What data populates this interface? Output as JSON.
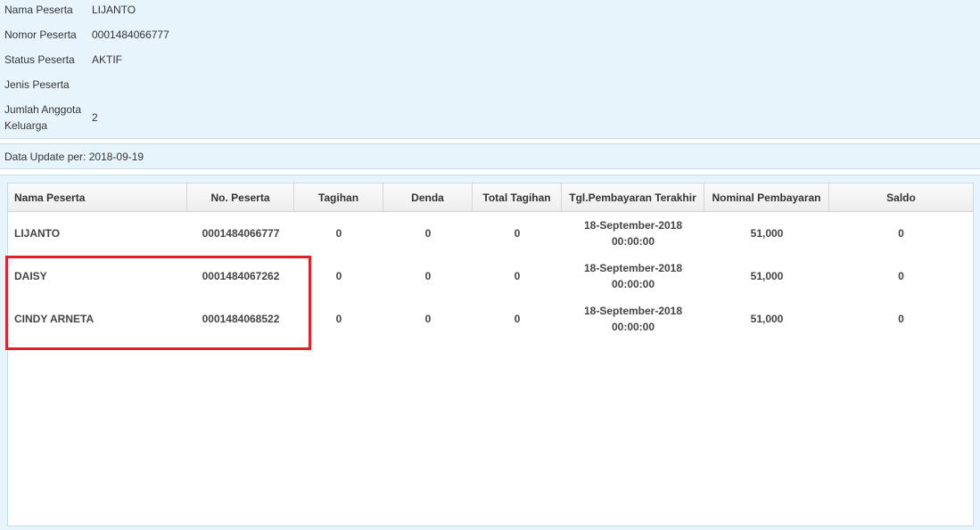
{
  "participant_info": {
    "fields": [
      {
        "label": "Nama Peserta",
        "value": "LIJANTO"
      },
      {
        "label": "Nomor Peserta",
        "value": "0001484066777"
      },
      {
        "label": "Status Peserta",
        "value": "AKTIF"
      },
      {
        "label": "Jenis Peserta",
        "value": ""
      },
      {
        "label": "Jumlah Anggota Keluarga",
        "value": "2"
      }
    ]
  },
  "update_bar": {
    "text": "Data Update per: 2018-09-19"
  },
  "table": {
    "columns": [
      "Nama Peserta",
      "No. Peserta",
      "Tagihan",
      "Denda",
      "Total Tagihan",
      "Tgl.Pembayaran Terakhir",
      "Nominal Pembayaran",
      "Saldo"
    ],
    "rows": [
      [
        "LIJANTO",
        "0001484066777",
        "0",
        "0",
        "0",
        "18-September-2018 00:00:00",
        "51,000",
        "0"
      ],
      [
        "DAISY",
        "0001484067262",
        "0",
        "0",
        "0",
        "18-September-2018 00:00:00",
        "51,000",
        "0"
      ],
      [
        "CINDY ARNETA",
        "0001484068522",
        "0",
        "0",
        "0",
        "18-September-2018 00:00:00",
        "51,000",
        "0"
      ]
    ]
  },
  "colors": {
    "panel_background": "#e8f4fc",
    "highlight_border": "#e3202a"
  }
}
